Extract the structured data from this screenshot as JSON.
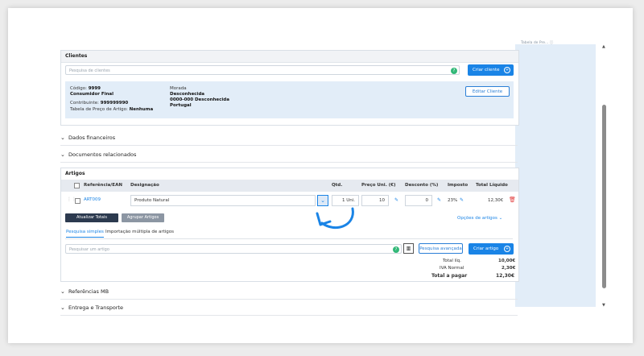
{
  "side_panel": {
    "text": "Tabela de Pre... ⓘ"
  },
  "clientes": {
    "title": "Clientes",
    "search_placeholder": "Pesquisa de clientes",
    "create_label": "Criar cliente",
    "edit_label": "Editar Cliente",
    "codigo_label": "Código:",
    "codigo_value": "9999",
    "name": "Consumidor Final",
    "contribuinte_label": "Contribuinte:",
    "contribuinte_value": "999999990",
    "tabela_label": "Tabela de Preço de Artigo:",
    "tabela_value": "Nenhuma",
    "morada_label": "Morada",
    "morada_line1": "Desconhecida",
    "morada_line2": "0000-000 Desconhecida",
    "morada_line3": "Portugal"
  },
  "sections": {
    "dados": "Dados financeiros",
    "documentos": "Documentos relacionados",
    "referencias": "Referências MB",
    "entrega": "Entrega e Transporte"
  },
  "artigos": {
    "title": "Artigos",
    "headers": {
      "ref": "Referência/EAN",
      "designacao": "Designação",
      "qtd": "Qtd.",
      "preco": "Preço Uni. (€)",
      "desconto": "Desconto (%)",
      "imposto": "Imposto",
      "total": "Total Líquido"
    },
    "row": {
      "ref": "ART009",
      "designacao": "Produto Natural",
      "qtd": "1 Uni.",
      "preco": "10",
      "desconto": "0",
      "imposto": "23%",
      "total": "12,30€"
    },
    "btn_atualizar": "Atualizar Totais",
    "btn_agrupar": "Agrupar Artigos",
    "opcoes": "Opções de artigos",
    "tab_simples": "Pesquisa simples",
    "tab_multipla": "Importação múltipla de artigos",
    "search_placeholder": "Pesquisar um artigo",
    "btn_avancada": "Pesquisa avançada",
    "btn_criar": "Criar artigo",
    "totals": {
      "liq_label": "Total líq.",
      "liq_value": "10,00€",
      "iva_label": "IVA Normal",
      "iva_value": "2,30€",
      "pagar_label": "Total a pagar",
      "pagar_value": "12,30€"
    }
  },
  "colors": {
    "primary": "#1a84e6",
    "light": "#e2edf8",
    "green": "#32b878",
    "dark": "#2c3a4f"
  }
}
